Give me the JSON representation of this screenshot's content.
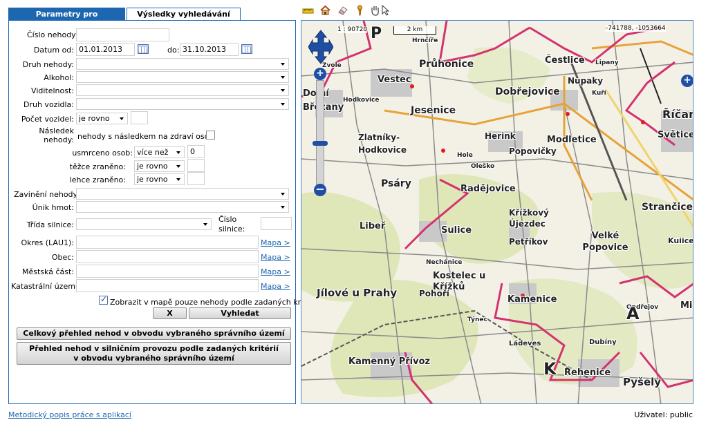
{
  "tabs": {
    "params": "Parametry pro vyhledávání",
    "results": "Výsledky vyhledávání"
  },
  "form": {
    "cislo_nehody_label": "Číslo nehody:",
    "datum_od_label": "Datum od:",
    "datum_od_value": "01.01.2013",
    "datum_do_label": "do:",
    "datum_do_value": "31.10.2013",
    "druh_nehody_label": "Druh nehody:",
    "alkohol_label": "Alkohol:",
    "viditelnost_label": "Viditelnost:",
    "druh_vozidla_label": "Druh vozidla:",
    "pocet_vozidel_label": "Počet vozidel:",
    "pocet_vozidel_value": "je rovno",
    "nasledek_label_1": "Následek",
    "nasledek_label_2": "nehody:",
    "nasledek_checkbox_label": "nehody s následkem na zdraví osob",
    "usmrceno_label": "usmrceno osob:",
    "usmrceno_value": "více než",
    "usmrceno_count": "0",
    "tezce_label": "těžce zraněno:",
    "tezce_value": "je rovno",
    "lehce_label": "lehce zraněno:",
    "lehce_value": "je rovno",
    "zavineni_label": "Zavinění nehody:",
    "unik_label": "Únik hmot:",
    "trida_label": "Třída silnice:",
    "cislo_silnice_label_1": "Číslo",
    "cislo_silnice_label_2": "silnice:",
    "okres_label": "Okres (LAU1):",
    "obec_label": "Obec:",
    "mestska_label": "Městská část:",
    "katastralni_label": "Katastrální území:",
    "mapa_link": "Mapa >",
    "zobrazit_label": "Zobrazit v mapě pouze nehody podle zadaných kritérií",
    "clear_button": "X",
    "search_button": "Vyhledat",
    "overview_button": "Celkový přehled nehod v obvodu vybraného správního území",
    "overview_filtered_line1": "Přehled nehod v silničním provozu podle zadaných kritérií",
    "overview_filtered_line2": "v obvodu vybraného správního území"
  },
  "map": {
    "scale_ratio": "1 : 90720",
    "scale_bar": "2 km",
    "coordinates": "-741788, -1053664",
    "places": [
      "Průhonice",
      "Čestlice",
      "Vestec",
      "Dobřejovice",
      "Nupaky",
      "Dolní Břežany",
      "Jesenice",
      "Říčany",
      "Světice",
      "Zlatníky-Hodkovice",
      "Herink",
      "Modletice",
      "Popovičky",
      "Psáry",
      "Radějovice",
      "Křížkový Újezdec",
      "Strančice",
      "Libeř",
      "Sulice",
      "Petříkov",
      "Velké Popovice",
      "Kostelec u Křížků",
      "Jílové u Prahy",
      "Pohoří",
      "Kamenice",
      "Kamenný Přívoz",
      "Řehenice",
      "Pyšely",
      "Lipany",
      "Kuří",
      "Hodkovice",
      "Nechánice",
      "Týnec",
      "Ládeves",
      "Dubíny",
      "Kuiice",
      "Hrnčíře",
      "Zvole",
      "Mi",
      "Oleško",
      "Hole",
      "Ondřejov"
    ],
    "letters": [
      "P",
      "A",
      "K"
    ]
  },
  "toolbar": {
    "icons": [
      "ruler-icon",
      "home-icon",
      "eraser-icon",
      "info-pin-icon",
      "pan-hand-icon",
      "select-arrow-icon"
    ]
  },
  "footer": {
    "link": "Metodický popis práce s aplikací",
    "user": "Uživatel: public"
  }
}
